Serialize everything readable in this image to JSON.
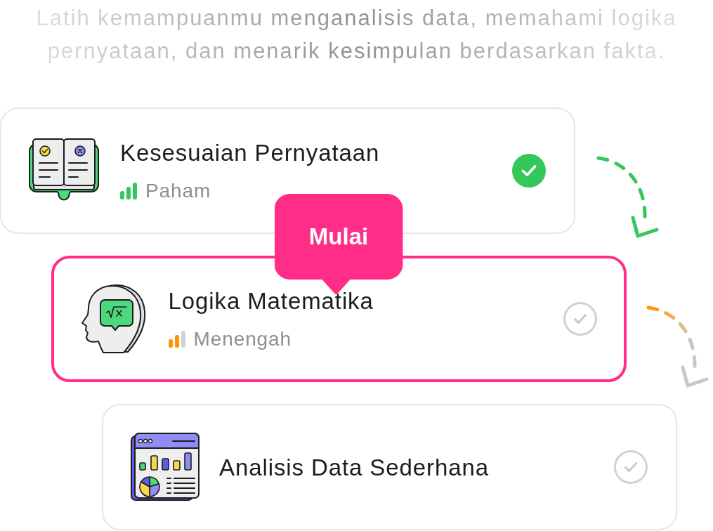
{
  "intro": "Latih kemampuanmu menganalisis data, memahami logika pernyataan, dan menarik kesimpulan berdasarkan fakta.",
  "lessons": [
    {
      "title": "Kesesuaian Pernyataan",
      "meter": {
        "label": "Paham",
        "level": 1,
        "color": "#34c759"
      },
      "completed": true,
      "selected": false
    },
    {
      "title": "Logika Matematika",
      "meter": {
        "label": "Menengah",
        "level": 0.67,
        "color": "#ff9500"
      },
      "completed": false,
      "selected": true,
      "callout": "Mulai"
    },
    {
      "title": "Analisis Data Sederhana",
      "completed": false,
      "selected": false
    }
  ]
}
